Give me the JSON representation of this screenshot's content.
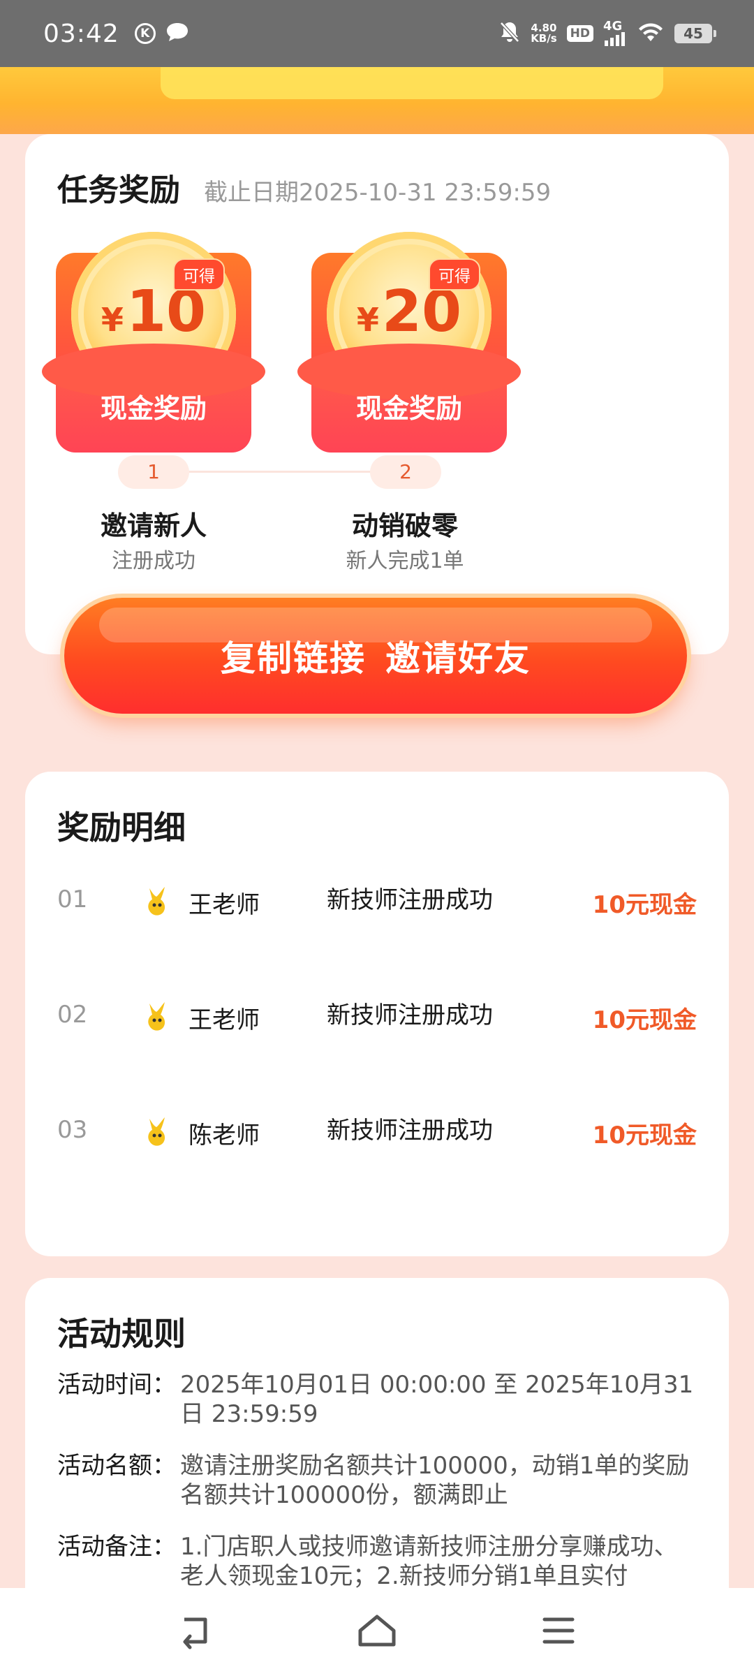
{
  "status_bar": {
    "time": "03:42",
    "k_glyph": "K",
    "net_speed_value": "4.80",
    "net_speed_unit": "KB/s",
    "hd_label": "HD",
    "network_type": "4G",
    "battery": "45"
  },
  "task": {
    "title": "任务奖励",
    "deadline": "截止日期2025-10-31  23:59:59",
    "rewards": [
      {
        "currency": "¥",
        "amount": "10",
        "badge": "可得",
        "label": "现金奖励"
      },
      {
        "currency": "¥",
        "amount": "20",
        "badge": "可得",
        "label": "现金奖励"
      }
    ],
    "steps": [
      {
        "num": "1",
        "title": "邀请新人",
        "subtitle": "注册成功"
      },
      {
        "num": "2",
        "title": "动销破零",
        "subtitle": "新人完成1单"
      }
    ],
    "cta_part1": "复制链接",
    "cta_part2": "邀请好友"
  },
  "details": {
    "title": "奖励明细",
    "rows": [
      {
        "index": "01",
        "name": "王老师",
        "desc": "新技师注册成功",
        "amount": "10元现金"
      },
      {
        "index": "02",
        "name": "王老师",
        "desc": "新技师注册成功",
        "amount": "10元现金"
      },
      {
        "index": "03",
        "name": "陈老师",
        "desc": "新技师注册成功",
        "amount": "10元现金"
      }
    ]
  },
  "rules": {
    "title": "活动规则",
    "items": [
      {
        "key": "活动时间：",
        "value": "2025年10月01日  00:00:00  至  2025年10月31日  23:59:59"
      },
      {
        "key": "活动名额：",
        "value": "邀请注册奖励名额共计100000，动销1单的奖励名额共计100000份，额满即止"
      },
      {
        "key": "活动备注：",
        "value": "1.门店职人或技师邀请新技师注册分享赚成功、老人领现金10元；2.新技师分销1单且实付"
      }
    ]
  },
  "colors": {
    "accent": "#f05a28",
    "page_bg": "#fde3dc",
    "status_bar": "#6e6e6e"
  },
  "icons": [
    "k-icon",
    "chat-icon",
    "mute-bell-icon",
    "wifi-icon",
    "signal-icon",
    "battery-icon",
    "back-icon",
    "home-icon",
    "menu-icon",
    "avatar-icon"
  ]
}
